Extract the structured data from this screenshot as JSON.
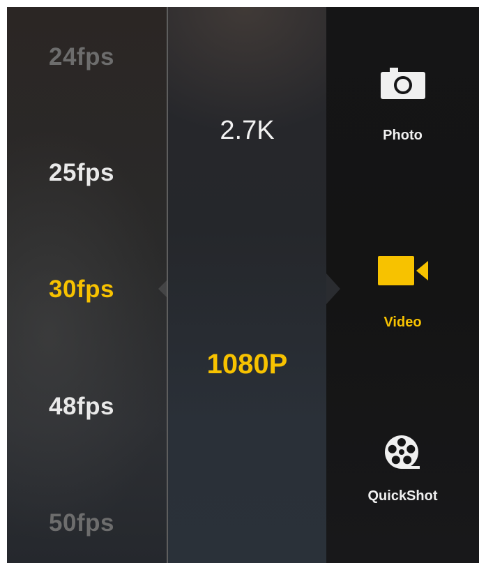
{
  "fps_options": [
    {
      "label": "24fps",
      "state": "dim"
    },
    {
      "label": "25fps",
      "state": "normal"
    },
    {
      "label": "30fps",
      "state": "selected"
    },
    {
      "label": "48fps",
      "state": "normal"
    },
    {
      "label": "50fps",
      "state": "dim"
    }
  ],
  "resolution_options": [
    {
      "label": "2.7K",
      "state": "normal"
    },
    {
      "label": "1080P",
      "state": "selected"
    }
  ],
  "modes": [
    {
      "label": "Photo",
      "icon": "camera-icon",
      "state": "normal"
    },
    {
      "label": "Video",
      "icon": "video-camera-icon",
      "state": "selected"
    },
    {
      "label": "QuickShot",
      "icon": "film-reel-icon",
      "state": "normal"
    }
  ],
  "colors": {
    "accent": "#f7c200",
    "text": "#e9e9e9",
    "dim_text": "#6d6d6d"
  }
}
